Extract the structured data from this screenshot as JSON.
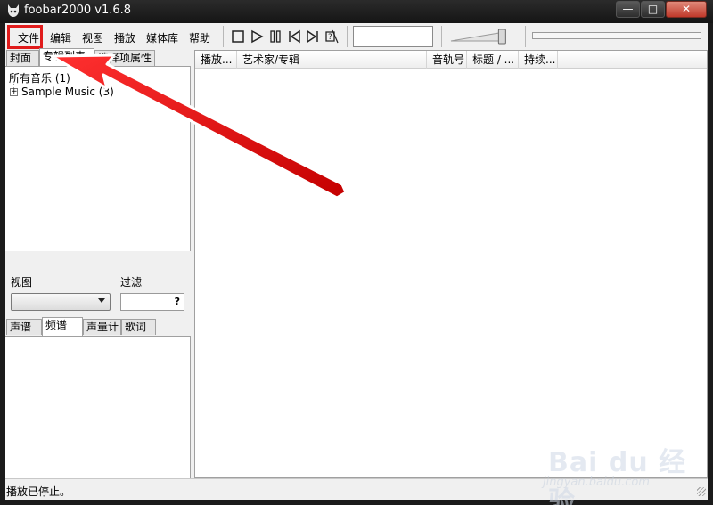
{
  "window": {
    "title": "foobar2000 v1.6.8",
    "controls": {
      "minimize": "—",
      "maximize": "□",
      "close": "✕"
    }
  },
  "menu": {
    "items": [
      "文件",
      "编辑",
      "视图",
      "播放",
      "媒体库",
      "帮助"
    ]
  },
  "toolbar": {
    "buttons": [
      "stop-icon",
      "play-icon",
      "pause-icon",
      "previous-icon",
      "next-icon",
      "random-icon"
    ],
    "search_value": "",
    "volume_level": 0.92,
    "seek_position": 0
  },
  "left_panel": {
    "top_tabs": [
      "封面",
      "专辑列表",
      "选择项属性"
    ],
    "active_top_tab": 1,
    "tree": {
      "root": "所有音乐 (1)",
      "children": [
        "Sample Music (3)"
      ]
    },
    "view_label": "视图",
    "filter_label": "过滤",
    "view_select_value": "",
    "filter_value": "",
    "filter_help": "?",
    "bottom_tabs": [
      "声谱",
      "频谱",
      "声量计",
      "歌词"
    ],
    "active_bottom_tab": 1
  },
  "playlist": {
    "columns": [
      "播放...",
      "艺术家/专辑",
      "音轨号",
      "标题 / ...",
      "持续..."
    ],
    "rows": []
  },
  "status": {
    "text": "播放已停止。"
  },
  "annotation": {
    "color": "#e01b1b"
  },
  "watermark": {
    "main": "Bai du 经验",
    "sub": "jingyan.baidu.com"
  }
}
